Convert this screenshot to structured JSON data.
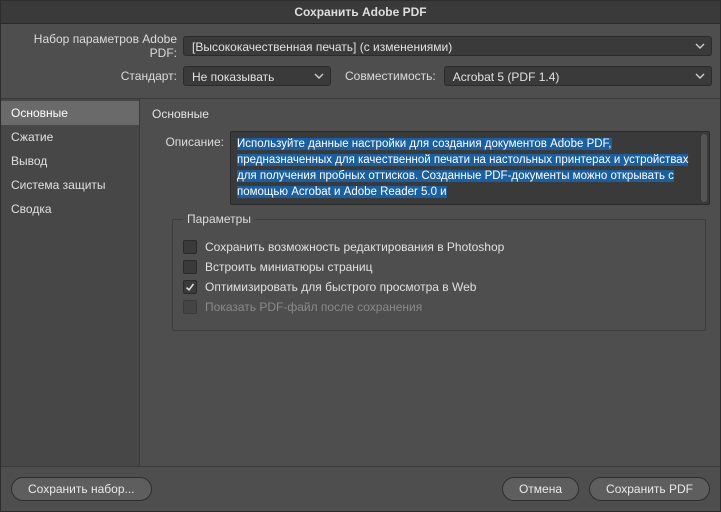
{
  "title": "Сохранить Adobe PDF",
  "top": {
    "preset_label": "Набор параметров Adobe PDF:",
    "preset_value": "[Высококачественная печать] (с изменениями)",
    "standard_label": "Стандарт:",
    "standard_value": "Не показывать",
    "compat_label": "Совместимость:",
    "compat_value": "Acrobat 5 (PDF 1.4)"
  },
  "sidebar": {
    "items": [
      {
        "label": "Основные",
        "active": true
      },
      {
        "label": "Сжатие",
        "active": false
      },
      {
        "label": "Вывод",
        "active": false
      },
      {
        "label": "Система защиты",
        "active": false
      },
      {
        "label": "Сводка",
        "active": false
      }
    ]
  },
  "main": {
    "title": "Основные",
    "desc_label": "Описание:",
    "desc_text": "Используйте данные настройки для создания документов Adobe PDF, предназначенных для качественной печати на настольных принтерах и устройствах для получения пробных оттисков.  Созданные PDF-документы можно  открывать с помощью Acrobat и Adobe Reader 5.0 и",
    "params_legend": "Параметры",
    "checkboxes": [
      {
        "label": "Сохранить возможность редактирования в Photoshop",
        "checked": false,
        "disabled": false
      },
      {
        "label": "Встроить миниатюры страниц",
        "checked": false,
        "disabled": false
      },
      {
        "label": "Оптимизировать для быстрого просмотра в Web",
        "checked": true,
        "disabled": false
      },
      {
        "label": "Показать PDF-файл после сохранения",
        "checked": false,
        "disabled": true
      }
    ]
  },
  "footer": {
    "save_preset": "Сохранить набор...",
    "cancel": "Отмена",
    "save_pdf": "Сохранить PDF"
  }
}
